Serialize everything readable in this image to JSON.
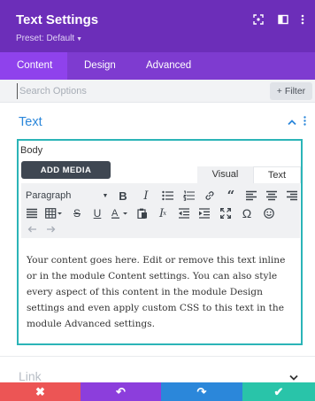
{
  "header": {
    "title": "Text Settings",
    "preset": "Preset: Default",
    "bg_color": "#6c2eb9",
    "icons": [
      "screenshot-icon",
      "split-view-icon",
      "kebab-menu-icon"
    ]
  },
  "tabs": [
    {
      "label": "Content",
      "active": true
    },
    {
      "label": "Design",
      "active": false
    },
    {
      "label": "Advanced",
      "active": false
    }
  ],
  "search": {
    "placeholder": "Search Options",
    "filter_label": "+ Filter"
  },
  "section": {
    "title": "Text",
    "color": "#2b87da"
  },
  "editor": {
    "field_label": "Body",
    "add_media_label": "ADD MEDIA",
    "mode_tabs": [
      "Visual",
      "Text"
    ],
    "active_mode": "Visual",
    "format_select": "Paragraph",
    "content": "Your content goes here. Edit or remove this text inline or in the module Content settings. You can also style every aspect of this content in the module Design settings and even apply custom CSS to this text in the module Advanced settings.",
    "border_color": "#2bb4b7"
  },
  "collapsed_section": {
    "title": "Link"
  },
  "footer": {
    "buttons": [
      {
        "name": "discard",
        "icon": "close-icon",
        "glyph": "✖",
        "color": "#ec5555"
      },
      {
        "name": "undo",
        "icon": "undo-icon",
        "glyph": "↶",
        "color": "#8c3edc"
      },
      {
        "name": "redo",
        "icon": "redo-icon",
        "glyph": "↷",
        "color": "#2b87da"
      },
      {
        "name": "save",
        "icon": "check-icon",
        "glyph": "✔",
        "color": "#29c4a9"
      }
    ]
  }
}
